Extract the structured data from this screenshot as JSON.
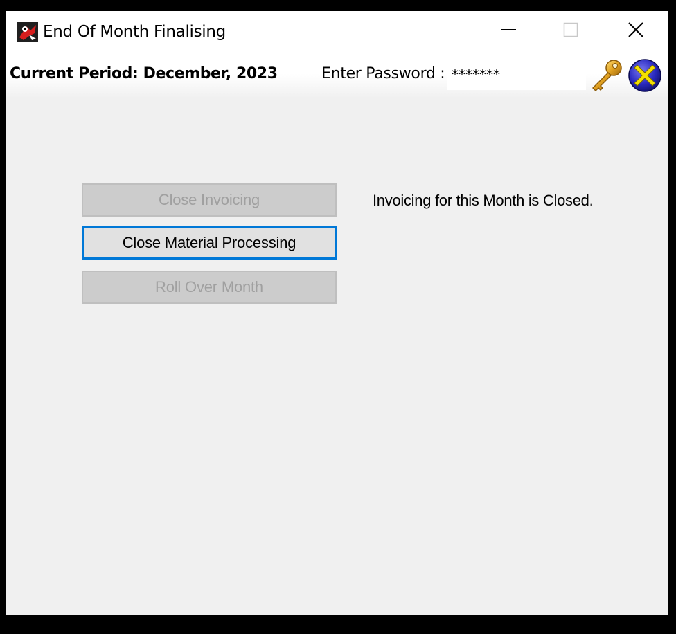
{
  "window": {
    "title": "End Of Month Finalising",
    "icon": "app-logo-icon",
    "controls": [
      "minimize-icon",
      "maximize-icon",
      "close-icon"
    ]
  },
  "header": {
    "period_label": "Current Period: December, 2023",
    "password_label": "Enter Password :",
    "password_value": "*******",
    "key_icon": "key-icon",
    "cancel_icon": "cancel-icon"
  },
  "actions": {
    "close_invoicing": {
      "label": "Close Invoicing",
      "enabled": false
    },
    "close_material": {
      "label": "Close Material Processing",
      "enabled": true
    },
    "roll_over": {
      "label": "Roll Over Month",
      "enabled": false
    }
  },
  "status": {
    "message": "Invoicing for this Month is Closed."
  },
  "colors": {
    "focus_border": "#0078d7",
    "window_bg": "#f0f0f0",
    "disabled_text": "#a0a0a0"
  }
}
